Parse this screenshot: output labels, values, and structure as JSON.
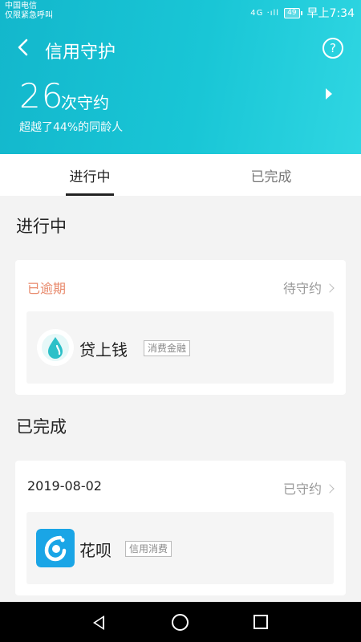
{
  "status_bar": {
    "carrier": "中国电信",
    "emergency": "仅限紧急呼叫",
    "signal": "4G ·ıll",
    "battery": "49",
    "time": "早上7:34"
  },
  "header": {
    "title": "信用守护"
  },
  "summary": {
    "count": "26",
    "count_unit": "次守约",
    "subtitle": "超越了44%的同龄人"
  },
  "tabs": [
    {
      "label": "进行中",
      "active": true
    },
    {
      "label": "已完成",
      "active": false
    }
  ],
  "sections": {
    "in_progress": {
      "title": "进行中",
      "card": {
        "header": "已逾期",
        "status": "待守约",
        "app_name": "贷上钱",
        "tag": "消费金融"
      }
    },
    "completed": {
      "title": "已完成",
      "card": {
        "header": "2019-08-02",
        "status": "已守约",
        "app_name": "花呗",
        "tag": "信用消费"
      }
    }
  },
  "colors": {
    "accent": "#19c6d6",
    "overdue": "#e8896b",
    "huabei": "#1aa5e6"
  }
}
